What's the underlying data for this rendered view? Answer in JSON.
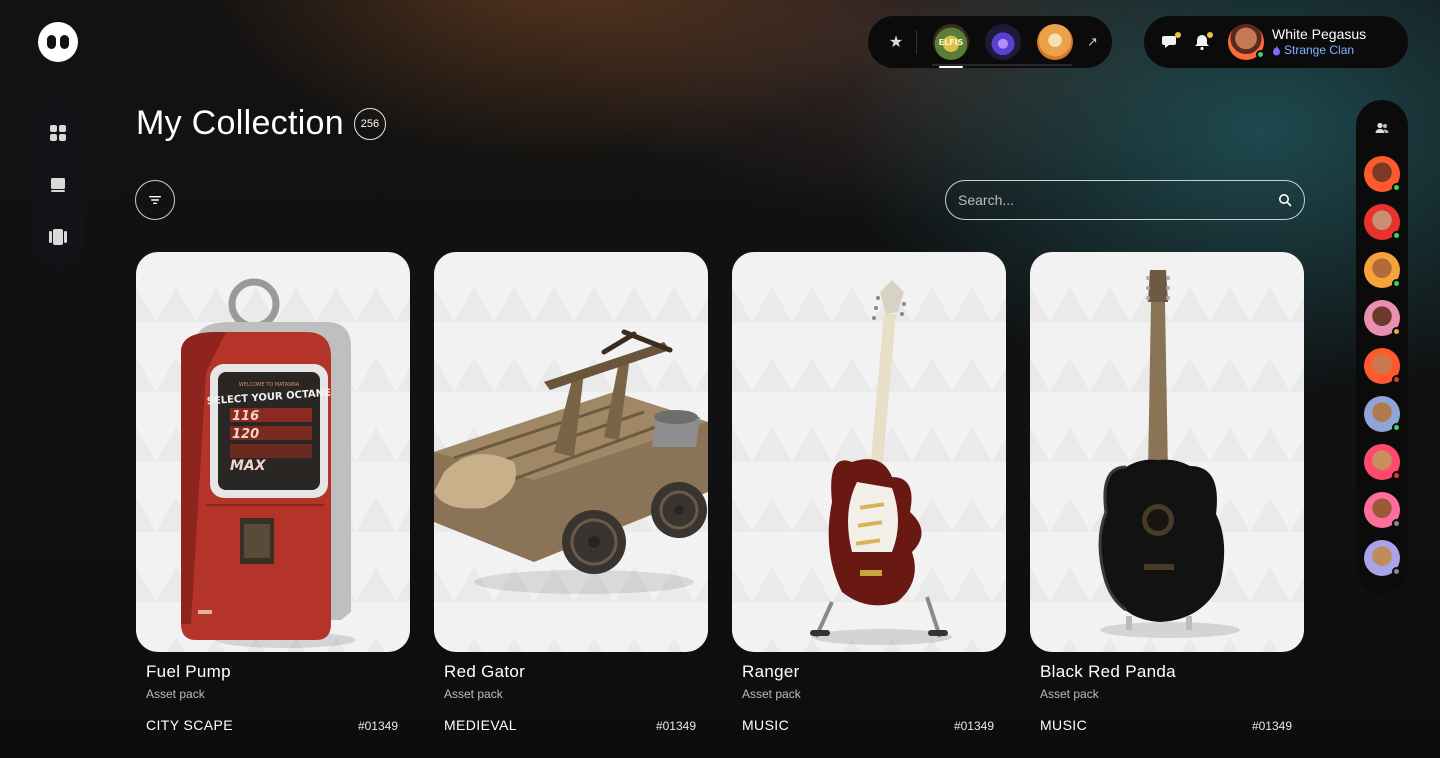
{
  "header": {
    "games": [
      {
        "name": "game-elfis",
        "color_a": "#5a7d3a",
        "color_b": "#d9c04a",
        "active": true
      },
      {
        "name": "game-mystic",
        "color_a": "#1b1b3a",
        "color_b": "#7b5cff",
        "active": false
      },
      {
        "name": "game-cat",
        "color_a": "#d7772a",
        "color_b": "#f4c06a",
        "active": false
      }
    ],
    "game_badge_text": "ELFIS",
    "user": {
      "name": "White Pegasus",
      "clan": "Strange Clan"
    }
  },
  "main": {
    "title": "My Collection",
    "count": "256",
    "search_placeholder": "Search..."
  },
  "items": [
    {
      "name": "Fuel Pump",
      "type": "Asset pack",
      "category": "CITY SCAPE",
      "id": "#01349",
      "screen_lines": [
        "WELCOME TO MATANNA",
        "SELECT YOUR OCTANE",
        "116",
        "120",
        "MAX"
      ]
    },
    {
      "name": "Red Gator",
      "type": "Asset pack",
      "category": "MEDIEVAL",
      "id": "#01349"
    },
    {
      "name": "Ranger",
      "type": "Asset pack",
      "category": "MUSIC",
      "id": "#01349"
    },
    {
      "name": "Black Red Panda",
      "type": "Asset pack",
      "category": "MUSIC",
      "id": "#01349"
    }
  ],
  "friends": [
    {
      "bg": "#ff5a2e",
      "face": "#7a3b22",
      "status": "#3ed35a"
    },
    {
      "bg": "#e8322e",
      "face": "#c89070",
      "status": "#3ed35a"
    },
    {
      "bg": "#f5a33a",
      "face": "#b36a3a",
      "status": "#3ed35a"
    },
    {
      "bg": "#e98fb0",
      "face": "#6b3a2a",
      "status": "#f5a33a"
    },
    {
      "bg": "#ff5a2e",
      "face": "#c87a4e",
      "status": "#e8322e"
    },
    {
      "bg": "#8fa4d8",
      "face": "#b07a4e",
      "status": "#3ed35a"
    },
    {
      "bg": "#ff4a6e",
      "face": "#c8905a",
      "status": "#e8322e"
    },
    {
      "bg": "#ff6e9a",
      "face": "#9a5a3a",
      "status": "#8a8a8a"
    },
    {
      "bg": "#a9a3e8",
      "face": "#c08a5a",
      "status": "#8a8a8a"
    }
  ]
}
